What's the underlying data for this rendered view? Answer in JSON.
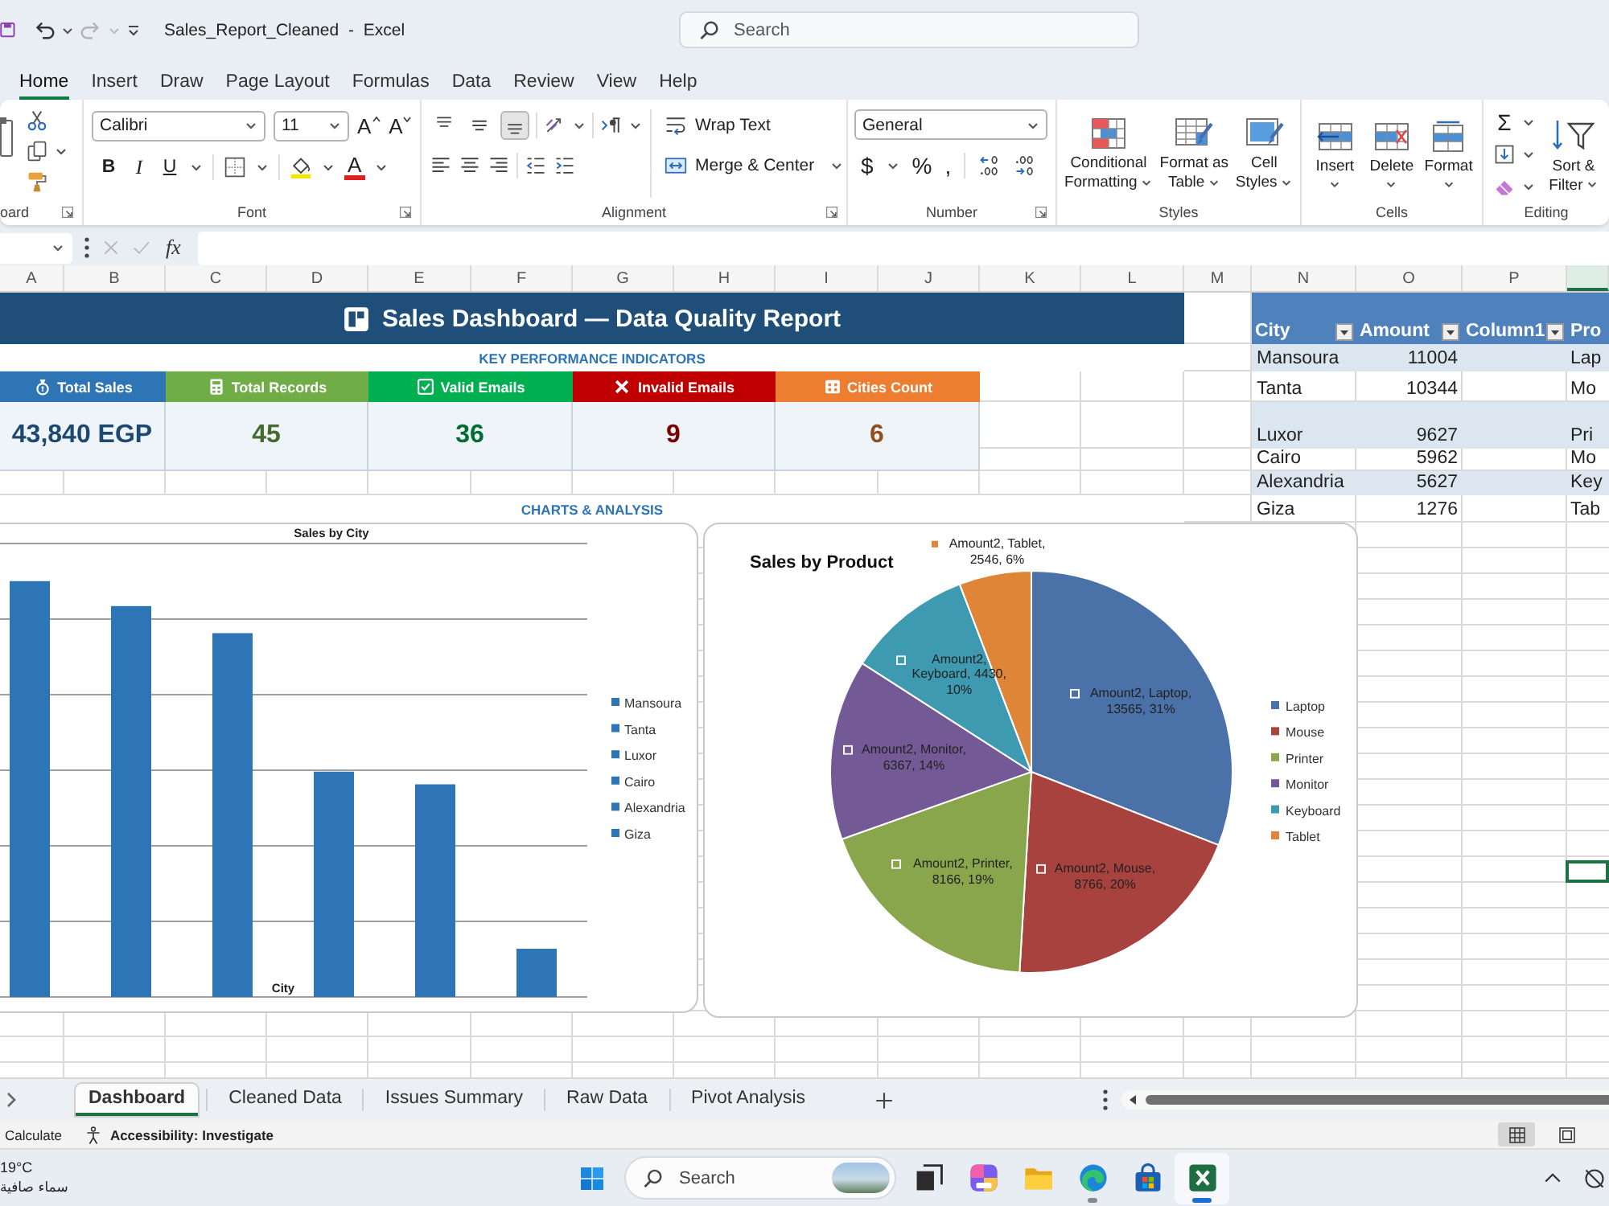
{
  "title_bar": {
    "undo": {
      "disabled": false
    },
    "redo": {
      "disabled": true
    },
    "title": "Sales_Report_Cleaned - Excel",
    "search": {
      "placeholder": "Search"
    }
  },
  "ribbon_tabs": [
    {
      "label": "Home",
      "selected": true
    },
    {
      "label": "Insert",
      "selected": false
    },
    {
      "label": "Draw",
      "selected": false
    },
    {
      "label": "Page Layout",
      "selected": false
    },
    {
      "label": "Formulas",
      "selected": false
    },
    {
      "label": "Data",
      "selected": false
    },
    {
      "label": "Review",
      "selected": false
    },
    {
      "label": "View",
      "selected": false
    },
    {
      "label": "Help",
      "selected": false
    }
  ],
  "ribbon": {
    "clipboard": {
      "label": "oard"
    },
    "font": {
      "font_name": "Calibri",
      "font_size": "11",
      "size_buttons": [
        "A",
        "A"
      ],
      "style_buttons": [
        "B",
        "I",
        "U"
      ],
      "font_color": "A",
      "label": "Font"
    },
    "alignment": {
      "vertical_buttons": [
        {
          "selected": false
        },
        {
          "selected": false
        },
        {
          "selected": true
        }
      ],
      "wrap_text": "Wrap Text",
      "merge_center": "Merge & Center",
      "label": "Alignment"
    },
    "number": {
      "format": "General",
      "symbols": [
        "$",
        "%",
        ","
      ],
      "label": "Number"
    },
    "styles": {
      "buttons": [
        "Conditional Formatting",
        "Format as Table",
        "Cell Styles"
      ],
      "label": "Styles"
    },
    "cells": {
      "buttons": [
        "Insert",
        "Delete",
        "Format"
      ],
      "label": "Cells"
    },
    "editing": {
      "autosum": "Σ",
      "sort_filter": "Sort & Filter",
      "label": "Editing"
    }
  },
  "formula_bar": {
    "cancel": {
      "disabled": true
    },
    "enter": {
      "disabled": true
    },
    "function_label": "fx"
  },
  "sheet": {
    "column_headers": [
      "A",
      "B",
      "C",
      "D",
      "E",
      "F",
      "G",
      "H",
      "I",
      "J",
      "K",
      "L",
      "M",
      "N",
      "O",
      "P"
    ],
    "dashboard": {
      "title": "Sales Dashboard — Data Quality Report",
      "kpi_heading": "KEY PERFORMANCE INDICATORS",
      "kpis": [
        {
          "label": "Total Sales",
          "value": "43,840 EGP",
          "color": "#2e75b6"
        },
        {
          "label": "Total Records",
          "value": "45",
          "color": "#70ad47"
        },
        {
          "label": "Valid Emails",
          "value": "36",
          "color": "#00b050"
        },
        {
          "label": "Invalid Emails",
          "value": "9",
          "color": "#c00000"
        },
        {
          "label": "Cities Count",
          "value": "6",
          "color": "#ed7d31"
        }
      ],
      "charts_heading": "CHARTS & ANALYSIS"
    },
    "table": {
      "columns": [
        "City",
        "Amount",
        "Column1",
        "Pro"
      ],
      "rows": [
        {
          "city": "Mansoura",
          "amount": "11004",
          "column_4": "Lap"
        },
        {
          "city": "Tanta",
          "amount": "10344",
          "column_4": "Mo"
        },
        {
          "city": "Luxor",
          "amount": "9627",
          "column_4": "Pri"
        },
        {
          "city": "Cairo",
          "amount": "5962",
          "column_4": "Mo"
        },
        {
          "city": "Alexandria",
          "amount": "5627",
          "column_4": "Key"
        },
        {
          "city": "Giza",
          "amount": "1276",
          "column_4": "Tab"
        }
      ]
    },
    "city_chart": {
      "title": "Sales by City",
      "xlabel": "City",
      "legend": [
        "Mansoura",
        "Tanta",
        "Luxor",
        "Cairo",
        "Alexandria",
        "Giza"
      ]
    },
    "product_chart": {
      "chart_data": {
        "type": "pie",
        "title": "Sales by Product",
        "categories": [
          "Laptop",
          "Mouse",
          "Printer",
          "Monitor",
          "Keyboard",
          "Tablet"
        ],
        "values": [
          13565,
          8766,
          8166,
          6367,
          4430,
          2546
        ],
        "value_labels": [
          "Amount2, Laptop, 13565, 31%",
          "Amount2, Mouse, 8766, 20%",
          "Amount2, Printer, 8166, 19%",
          "Amount2, Monitor, 6367, 14%",
          "Amount2, Keyboard, 4430, 10%",
          "Amount2, Tablet, 2546, 6%"
        ],
        "legend": "right"
      }
    }
  },
  "sheet_tabs": [
    {
      "label": "Dashboard",
      "selected": true
    },
    {
      "label": "Cleaned Data",
      "selected": false
    },
    {
      "label": "Issues Summary",
      "selected": false
    },
    {
      "label": "Raw Data",
      "selected": false
    },
    {
      "label": "Pivot Analysis",
      "selected": false
    }
  ],
  "status_bar": {
    "mode": "Calculate",
    "accessibility": "Accessibility: Investigate",
    "views": [
      {
        "selected": true
      },
      {
        "selected": false
      }
    ]
  },
  "taskbar": {
    "weather": {
      "temperature": "19°C",
      "condition": "سماء صافية"
    },
    "search": {
      "placeholder": "Search"
    },
    "apps": [
      {
        "open": false,
        "active": false
      },
      {
        "open": false,
        "active": false
      },
      {
        "open": false,
        "active": false
      },
      {
        "open": true,
        "active": false
      },
      {
        "open": false,
        "active": false
      },
      {
        "open": true,
        "active": true
      }
    ]
  }
}
